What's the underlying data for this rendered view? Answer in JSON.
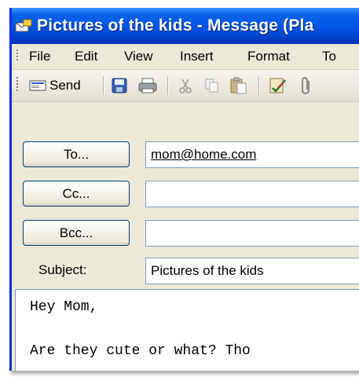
{
  "window": {
    "title": "Pictures of the kids - Message (Pla"
  },
  "menu": {
    "items": [
      {
        "label": "File"
      },
      {
        "label": "Edit"
      },
      {
        "label": "View"
      },
      {
        "label": "Insert"
      },
      {
        "label": "Format"
      },
      {
        "label": "To"
      }
    ]
  },
  "toolbar": {
    "send_label": "Send"
  },
  "header": {
    "to_button": "To...",
    "cc_button": "Cc...",
    "bcc_button": "Bcc...",
    "to_value": "mom@home.com",
    "cc_value": "",
    "bcc_value": "",
    "subject_label": "Subject:",
    "subject_value": "Pictures of the kids"
  },
  "body": {
    "line1": "Hey Mom,",
    "line2": "",
    "line3": "Are they cute or what? Tho"
  },
  "colors": {
    "titlebar": "#0058e6",
    "window_bg": "#ece9d8",
    "field_border": "#7f9db9"
  }
}
